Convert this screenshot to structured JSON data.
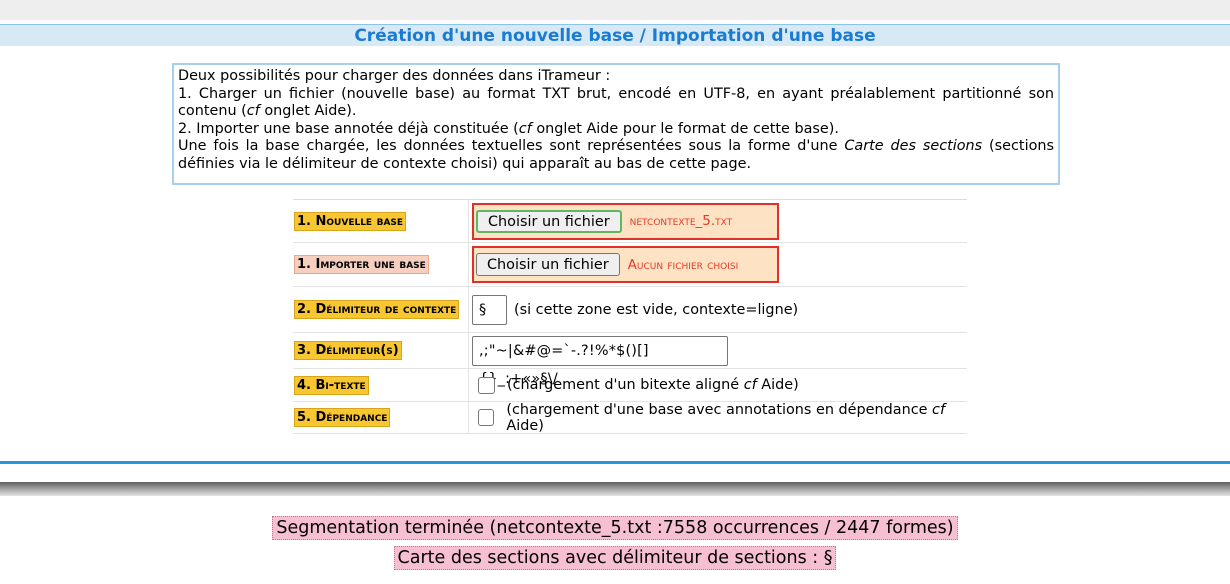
{
  "title": "Création d'une nouvelle base / Importation d'une base",
  "intro": {
    "line1": "Deux possibilités pour charger des données dans iTrameur :",
    "item1_a": "1. Charger un fichier (nouvelle base) au format TXT brut, encodé en UTF-8, en ayant préalablement partitionné son contenu (",
    "item1_cf": "cf",
    "item1_b": " onglet Aide).",
    "item2_a": "2. Importer une base annotée déjà constituée (",
    "item2_cf": "cf",
    "item2_b": " onglet Aide pour le format de cette base).",
    "line4_a": "Une fois la base chargée, les données textuelles sont représentées sous la forme d'une ",
    "line4_em": "Carte des sections",
    "line4_b": " (sections définies via le délimiteur de contexte choisi) qui apparaît au bas de cette page."
  },
  "form": {
    "nouvelle_base": {
      "label": "1. Nouvelle base",
      "button": "Choisir un fichier",
      "status": "netcontexte_5.txt"
    },
    "importer_base": {
      "label": "1. Importer une base",
      "button": "Choisir un fichier",
      "status": "Aucun fichier choisi"
    },
    "delimiteur_contexte": {
      "label": "2. Délimiteur de contexte",
      "value": "§",
      "hint": "(si cette zone est vide, contexte=ligne)"
    },
    "delimiteurs": {
      "label": "3. Délimiteur(s)",
      "value": ",;\"~|&#@=`-.?!%*$()[]{}_:+«»§\\/"
    },
    "bitexte": {
      "label": "4. Bi-texte",
      "hint_a": "(chargement d'un bitexte aligné ",
      "hint_cf": "cf",
      "hint_b": " Aide)"
    },
    "dependance": {
      "label": "5. Dépendance",
      "hint_a": "(chargement d'une base avec annotations en dépendance ",
      "hint_cf": "cf",
      "hint_b": " Aide)"
    }
  },
  "status": {
    "segmentation": "Segmentation terminée (netcontexte_5.txt :7558 occurrences / 2447 formes)",
    "carte": "Carte des sections avec délimiteur de sections : §"
  }
}
